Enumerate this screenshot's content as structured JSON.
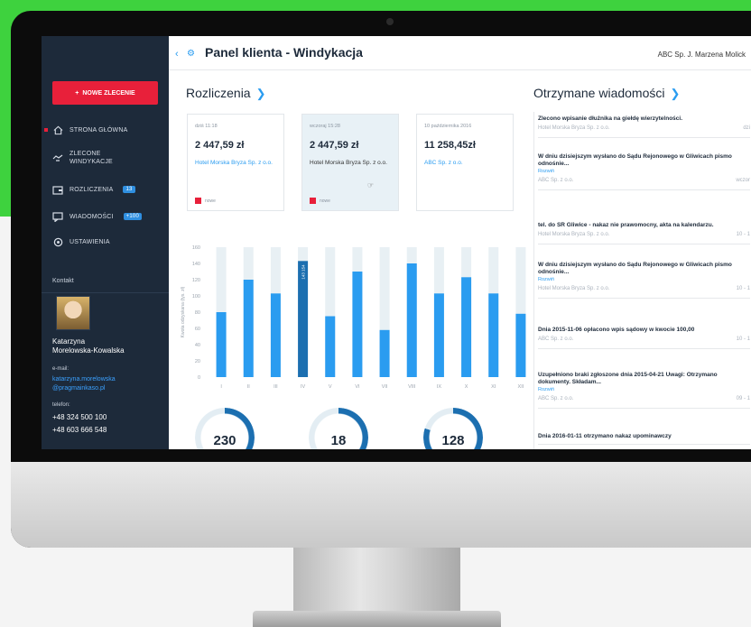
{
  "app": {
    "title": "Panel klienta - Windykacja",
    "user": "ABC Sp. J. Marzena Molick"
  },
  "sidebar": {
    "new_button": "NOWE ZLECENIE",
    "items": [
      {
        "label": "STRONA GŁÓWNA",
        "icon": "home-icon",
        "active": true
      },
      {
        "label": "ZLECONE WINDYKACJE",
        "icon": "handshake-icon",
        "active": false
      },
      {
        "label": "ROZLICZENIA",
        "icon": "wallet-icon",
        "badge": "13",
        "active": false
      },
      {
        "label": "WIADOMOŚCI",
        "icon": "message-icon",
        "badge": "+100",
        "active": false
      },
      {
        "label": "USTAWIENIA",
        "icon": "settings-icon",
        "active": false
      }
    ],
    "contact": {
      "title": "Kontakt",
      "name_line1": "Katarzyna",
      "name_line2": "Morelowska-Kowalska",
      "email_label": "e-mail:",
      "email_line1": "katarzyna.morelowska",
      "email_line2": "@pragmainkaso.pl",
      "phone_label": "telefon:",
      "phone1": "+48 324 500 100",
      "phone2": "+48 603 666 548"
    }
  },
  "settlements": {
    "title": "Rozliczenia",
    "cards": [
      {
        "date": "dziś 11:18",
        "amount": "2 447,59 zł",
        "company": "Hotel Morska Bryza Sp. z o.o.",
        "status": "nowe"
      },
      {
        "date": "wczoraj 15:28",
        "amount": "2 447,59 zł",
        "company": "Hotel Morska Bryza Sp. z o.o.",
        "status": "nowe"
      },
      {
        "date": "10 października 2016",
        "amount": "11 258,45zł",
        "company": "ABC Sp. z o.o.",
        "status": ""
      }
    ]
  },
  "chart_data": {
    "type": "bar",
    "ylabel": "Kwota odzyskana (tys. zł)",
    "ylim": [
      0,
      160
    ],
    "yticks": [
      "0",
      "20",
      "40",
      "60",
      "80",
      "100",
      "120",
      "140",
      "160"
    ],
    "categories": [
      "I",
      "II",
      "III",
      "IV",
      "V",
      "VI",
      "VII",
      "VIII",
      "IX",
      "X",
      "XI",
      "XII"
    ],
    "values": [
      80,
      120,
      103,
      143,
      75,
      130,
      58,
      140,
      103,
      123,
      103,
      78
    ],
    "highlight_index": 3,
    "highlight_label": "143 154",
    "colors": {
      "bar": "#2a9cf0",
      "highlight": "#1c6fb0",
      "track": "#e8f0f4"
    }
  },
  "donuts": [
    {
      "value": "230",
      "fraction": 0.45
    },
    {
      "value": "18",
      "fraction": 0.62
    },
    {
      "value": "128",
      "fraction": 0.8
    }
  ],
  "messages": {
    "title": "Otrzymane wiadomości",
    "items": [
      {
        "text": "Zlecono wpisanie dłużnika na giełdę wierzytelności.",
        "link": "",
        "company": "Hotel Morska Bryza Sp. z o.o.",
        "date": "dzi"
      },
      {
        "text": "W dniu dzisiejszym wysłano do Sądu Rejonowego w Gliwicach pismo odnośnie...",
        "link": "Rozwiń",
        "company": "ABC Sp. z o.o.",
        "date": "wczor"
      },
      {
        "text": "tel. do SR Gliwice - nakaz nie prawomocny, akta na kalendarzu.",
        "link": "",
        "company": "Hotel Morska Bryza Sp. z o.o.",
        "date": "10 - 1"
      },
      {
        "text": "W dniu dzisiejszym wysłano do Sądu Rejonowego w Gliwicach pismo odnośnie...",
        "link": "Rozwiń",
        "company": "Hotel Morska Bryza Sp. z o.o.",
        "date": "10 - 1"
      },
      {
        "text": "Dnia 2015-11-06 opłacono wpis sądowy w kwocie 100,00",
        "link": "",
        "company": "ABC Sp. z o.o.",
        "date": "10 - 1"
      },
      {
        "text": "Uzupełniono braki zgłoszone dnia 2015-04-21 Uwagi: Otrzymano dokumenty. Składam...",
        "link": "Rozwiń",
        "company": "ABC Sp. z o.o.",
        "date": "09 - 1"
      },
      {
        "text": "Dnia 2016-01-11 otrzymano nakaz upominawczy",
        "link": "",
        "company": "",
        "date": ""
      }
    ]
  }
}
